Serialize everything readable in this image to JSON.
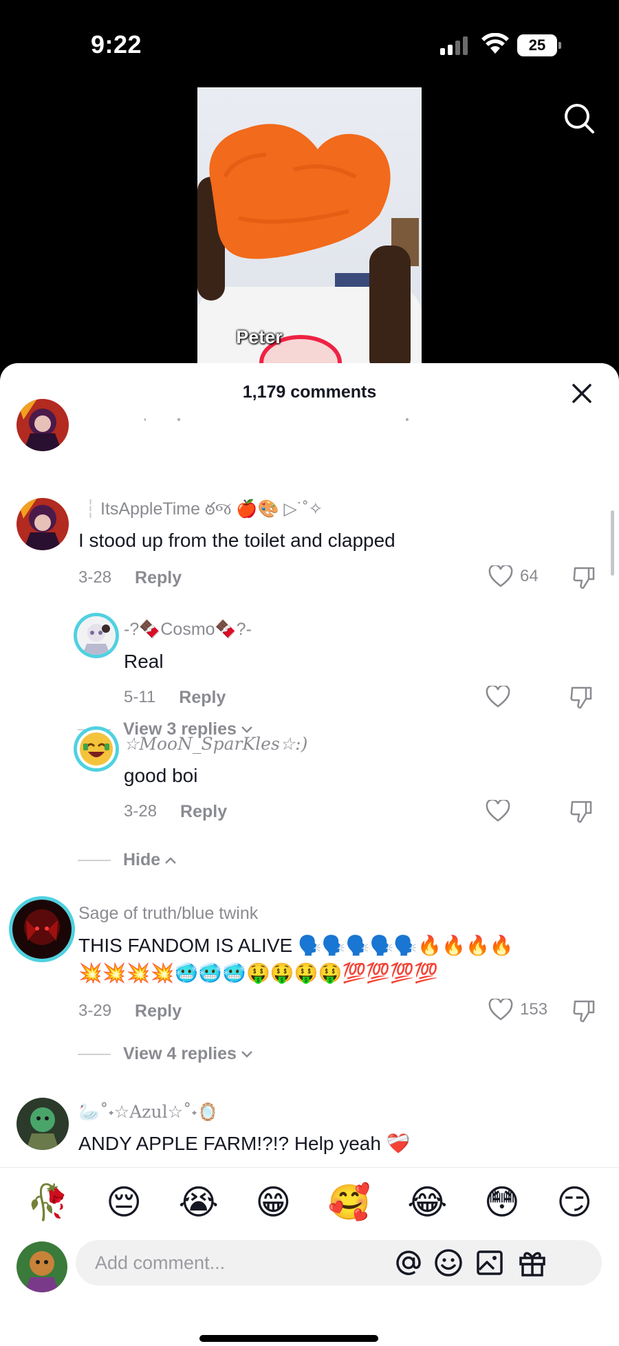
{
  "status": {
    "time": "9:22",
    "battery": "25"
  },
  "video": {
    "caption": "Peter"
  },
  "sheet": {
    "title": "1,179 comments"
  },
  "comments": [
    {
      "toggle": "View 3 replies",
      "username": "ItsAppleTime ఠજ 🍎🎨 ▷˙˚✧",
      "text": "I stood up from the toilet and clapped",
      "date": "3-28",
      "reply": "Reply",
      "likes": "64",
      "replies": [
        {
          "username": "-?🍫Cosmo🍫?-",
          "text": "Real",
          "date": "5-11",
          "reply": "Reply"
        },
        {
          "username": "☆MooN_SparKles☆:)",
          "text": "good boi",
          "date": "3-28",
          "reply": "Reply"
        }
      ],
      "hide_label": "Hide"
    },
    {
      "username": "Sage of truth/blue twink",
      "text_line1": "THIS FANDOM IS ALIVE 🗣️🗣️🗣️🗣️🗣️🔥🔥🔥🔥",
      "text_line2": "💥💥💥💥🥶🥶🥶🤑🤑🤑🤑💯💯💯💯",
      "date": "3-29",
      "reply": "Reply",
      "likes": "153",
      "toggle": "View 4 replies"
    },
    {
      "username": "🦢˚˖☆Azul☆˚˖🪞",
      "text": "ANDY APPLE FARM!?!? Help yeah ❤️‍🩹"
    }
  ],
  "quick_emojis": [
    "🥀",
    "😔",
    "😭",
    "😁",
    "🥰",
    "😂",
    "😳",
    "😏"
  ],
  "composer": {
    "placeholder": "Add comment..."
  },
  "colors": {
    "accent_ring": "#4fd1e0",
    "muted_text": "#8a8b91",
    "primary_text": "#161823"
  }
}
